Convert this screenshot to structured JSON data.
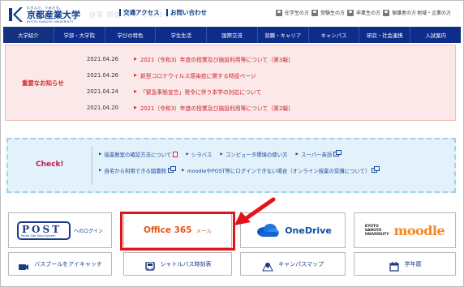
{
  "header": {
    "logo_tagline": "むすんで、うみだす。",
    "logo_name": "京都産業大学",
    "logo_en": "KYOTO SANGYO UNIVERSITY",
    "ghost_text": "授業 関係 大学 のお知らせ",
    "links": [
      "交通アクセス",
      "お問い合わせ"
    ],
    "audiences": [
      "在学生の方",
      "受験生の方",
      "卒業生の方",
      "保護者の方",
      "地域・企業の方"
    ]
  },
  "nav": {
    "items": [
      "大学紹介",
      "学部・大学院",
      "学びの特色",
      "学生生活",
      "国際交流",
      "就職・キャリア",
      "キャンパス",
      "研究・社会連携",
      "入試案内"
    ]
  },
  "notices": {
    "title": "重要なお知らせ",
    "items": [
      {
        "date": "2021.04.26",
        "text": "2021（令和3）年度の授業及び施設利用等について（第3報）"
      },
      {
        "date": "2021.04.26",
        "text": "新型コロナウイルス感染症に関する特設ページ"
      },
      {
        "date": "2021.04.24",
        "text": "「緊急事態宣言」発令に伴う本学の対応について"
      },
      {
        "date": "2021.04.20",
        "text": "2021（令和3）年度の授業及び施設利用等について（第2報）"
      }
    ]
  },
  "check": {
    "label": "Check!",
    "row1": [
      "授業教室の確認方法について",
      "シラバス",
      "コンピュータ環境の使い方",
      "スーパー英語"
    ],
    "row2": [
      "自宅から利用できる図書館",
      "moodleやPOST等にログインできない場合（オンライン授業の受講について）"
    ]
  },
  "tiles": {
    "post_word": "POST",
    "post_sub": "Portal Site Total System",
    "post_login": "へのログイン",
    "office": "Office 365",
    "office_sub": "メール",
    "onedrive": "OneDrive",
    "moodle_uni": [
      "KYOTO",
      "SANGYO",
      "UNIVERSITY"
    ],
    "moodle": "moodle",
    "bus_catch": "バスブールをアイキャッチ",
    "shuttle": "シャトルバス時刻表",
    "campus_map": "キャンパスマップ",
    "calendar": "学年暦"
  },
  "colors": {
    "nav_bg": "#0e2d8a",
    "notice_red": "#d0272a",
    "office_orange": "#e2571b",
    "highlight_red": "#e1141b",
    "moodle_orange": "#f5881f"
  }
}
